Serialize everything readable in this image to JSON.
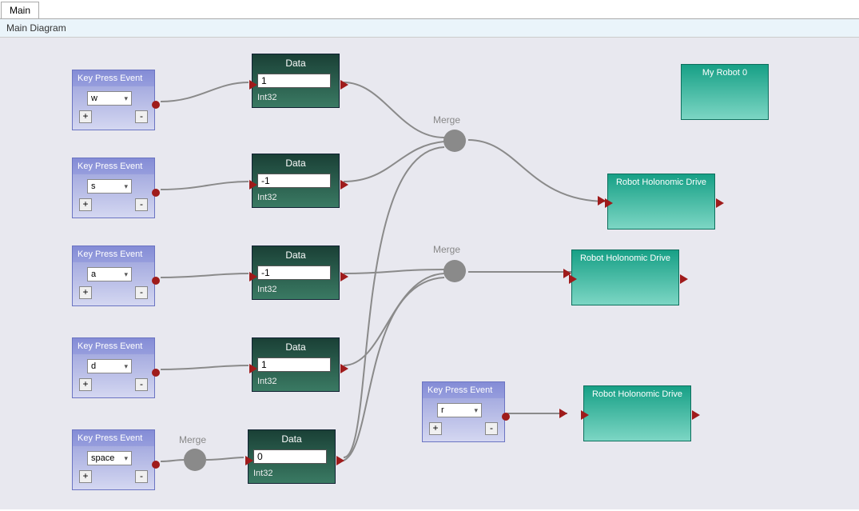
{
  "header": {
    "tab_label": "Main",
    "subheader": "Main Diagram"
  },
  "keypress_nodes": [
    {
      "title": "Key Press Event",
      "value": "w",
      "plus": "+",
      "minus": "-"
    },
    {
      "title": "Key Press Event",
      "value": "s",
      "plus": "+",
      "minus": "-"
    },
    {
      "title": "Key Press Event",
      "value": "a",
      "plus": "+",
      "minus": "-"
    },
    {
      "title": "Key Press Event",
      "value": "d",
      "plus": "+",
      "minus": "-"
    },
    {
      "title": "Key Press Event",
      "value": "space",
      "plus": "+",
      "minus": "-"
    },
    {
      "title": "Key Press Event",
      "value": "r",
      "plus": "+",
      "minus": "-"
    }
  ],
  "data_nodes": [
    {
      "title": "Data",
      "value": "1",
      "type": "Int32"
    },
    {
      "title": "Data",
      "value": "-1",
      "type": "Int32"
    },
    {
      "title": "Data",
      "value": "-1",
      "type": "Int32"
    },
    {
      "title": "Data",
      "value": "1",
      "type": "Int32"
    },
    {
      "title": "Data",
      "value": "0",
      "type": "Int32"
    }
  ],
  "merge_labels": [
    "Merge",
    "Merge",
    "Merge"
  ],
  "teal_nodes": [
    {
      "title": "My Robot 0"
    },
    {
      "title": "Robot Holonomic Drive"
    },
    {
      "title": "Robot Holonomic Drive"
    },
    {
      "title": "Robot Holonomic Drive"
    }
  ],
  "colors": {
    "keypress_bg": "#848cd6",
    "data_bg": "#1a4036",
    "teal_bg": "#17a086",
    "port_red": "#9f1b1b",
    "merge_gray": "#8a8a8a",
    "canvas_bg": "#e8e8ef"
  }
}
